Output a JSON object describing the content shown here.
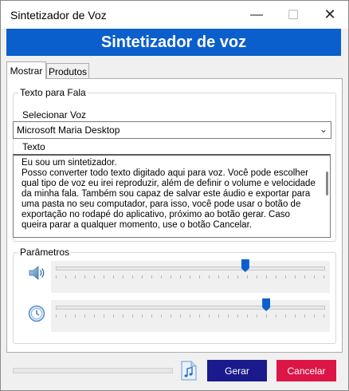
{
  "window": {
    "title": "Sintetizador de Voz"
  },
  "banner": {
    "title": "Sintetizador de voz"
  },
  "tabs": [
    {
      "label": "Mostrar",
      "active": true
    },
    {
      "label": "Produtos",
      "active": false
    }
  ],
  "text_group": {
    "legend": "Texto para Fala",
    "voice_label": "Selecionar Voz",
    "voice_value": "Microsoft Maria Desktop",
    "text_label": "Texto",
    "text_value": "Eu sou um sintetizador.\nPosso converter todo texto digitado aqui para voz. Você pode escolher qual tipo de voz eu irei reproduzir, além de definir o volume e velocidade da minha fala. Também sou capaz de salvar este áudio e exportar para uma pasta no seu computador, para isso, você pode usar o botão de exportação no rodapé do aplicativo, próximo ao botão gerar. Caso queira parar a qualquer momento, use o botão Cancelar."
  },
  "params_group": {
    "legend": "Parâmetros",
    "volume_level": 0.71,
    "speed_level": 0.79
  },
  "footer": {
    "progress": 0,
    "gerar_label": "Gerar",
    "cancel_label": "Cancelar"
  },
  "colors": {
    "accent": "#0b5fcc",
    "gerar": "#1a1a8c",
    "cancel": "#dc1547"
  },
  "icons": [
    "minimize-icon",
    "maximize-icon",
    "close-icon",
    "chevron-down-icon",
    "speaker-icon",
    "speed-icon",
    "music-file-icon"
  ]
}
